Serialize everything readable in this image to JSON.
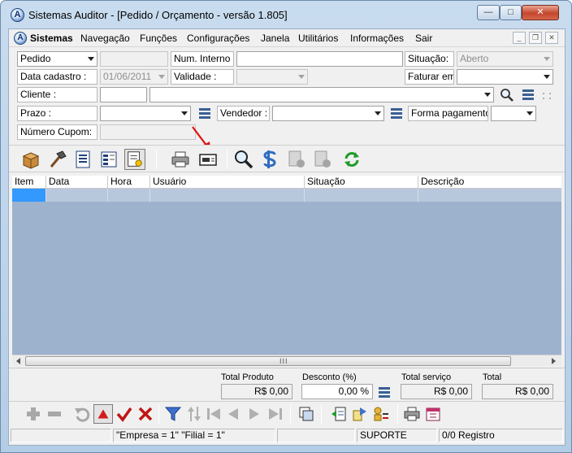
{
  "window": {
    "title": "Sistemas Auditor - [Pedido / Orçamento - versão 1.805]",
    "app_icon_letter": "A",
    "controls": {
      "minimize": "—",
      "maximize": "□",
      "close": "✕"
    }
  },
  "menubar": {
    "icon_letter": "A",
    "items": [
      "Sistemas",
      "Navegação",
      "Funções",
      "Configurações",
      "Janela",
      "Utilitários",
      "Informações",
      "Sair"
    ],
    "mdi_controls": {
      "minimize": "_",
      "restore": "❐",
      "close": "✕"
    }
  },
  "form": {
    "tipo": {
      "value": "Pedido"
    },
    "num_interno": {
      "label": "Num. Interno :",
      "value": ""
    },
    "situacao": {
      "label": "Situação:",
      "value": "Aberto"
    },
    "data_cadastro": {
      "label": "Data cadastro :",
      "value": "01/06/2011"
    },
    "validade": {
      "label": "Validade :",
      "value": ""
    },
    "faturar_em": {
      "label": "Faturar em:",
      "value": ""
    },
    "cliente": {
      "label": "Cliente :",
      "code": "",
      "name": ""
    },
    "prazo": {
      "label": "Prazo :",
      "value": ""
    },
    "vendedor": {
      "label": "Vendedor :",
      "value": ""
    },
    "forma_pagamento": {
      "label": "Forma pagamento:",
      "value": ""
    },
    "numero_cupom": {
      "label": "Número Cupom:",
      "value": ""
    }
  },
  "grid": {
    "columns": [
      "Item",
      "Data",
      "Hora",
      "Usuário",
      "Situação",
      "Descrição"
    ],
    "scroll_grip": "III"
  },
  "totals": {
    "total_produto": {
      "label": "Total Produto",
      "value": "R$ 0,00"
    },
    "desconto": {
      "label": "Desconto (%)",
      "value": "0,00 %"
    },
    "total_servico": {
      "label": "Total serviço",
      "value": "R$ 0,00"
    },
    "total": {
      "label": "Total",
      "value": "R$ 0,00"
    }
  },
  "statusbar": {
    "panels": [
      "",
      "\"Empresa = 1\"   \"Filial = 1\"",
      "",
      "SUPORTE",
      "0/0 Registro"
    ]
  },
  "colors": {
    "grid_body": "#9db2cc",
    "grid_row": "#b7c8dc",
    "selected_cell": "#3399ff",
    "annotation_arrow": "#e01010"
  }
}
